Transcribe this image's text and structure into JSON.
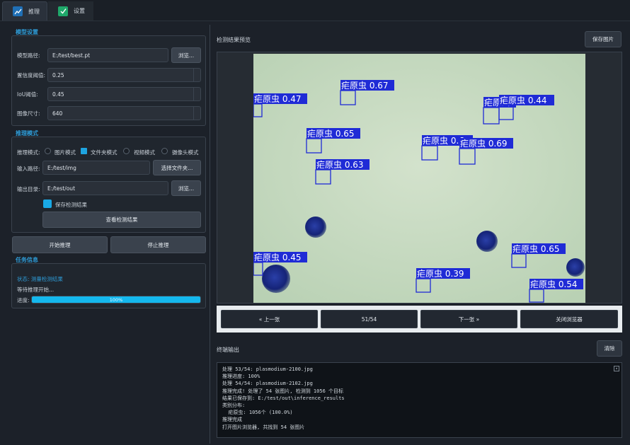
{
  "tabs": [
    {
      "label": "推理",
      "icon": "chart-line-icon",
      "active": true
    },
    {
      "label": "设置",
      "icon": "check-square-icon",
      "active": false
    }
  ],
  "model_settings": {
    "title": "模型设置",
    "model_path_label": "模型路径:",
    "model_path_value": "E:/test/best.pt",
    "browse_label": "浏览...",
    "confidence_label": "置信度阈值:",
    "confidence_value": "0.25",
    "iou_label": "IoU阈值:",
    "iou_value": "0.45",
    "image_size_label": "图像尺寸:",
    "image_size_value": "640"
  },
  "inference_mode": {
    "title": "推理模式",
    "mode_label": "推理模式:",
    "options": [
      "图片模式",
      "文件夹模式",
      "视频模式",
      "摄像头模式"
    ],
    "selected": "文件夹模式",
    "input_label": "输入路径:",
    "input_value": "E:/test/img",
    "choose_folder_label": "选择文件夹...",
    "output_label": "输出目录:",
    "output_value": "E:/test/out",
    "browse_label": "浏览...",
    "save_results_label": "保存检测结果",
    "view_results_label": "查看检测结果"
  },
  "actions": {
    "start_label": "开始推理",
    "stop_label": "停止推理"
  },
  "task_info": {
    "title": "任务信息",
    "status_text": "状态: 测量检测结果",
    "waiting_text": "等待推理开始...",
    "progress_label": "进度:",
    "progress_text": "100%",
    "progress_value": 100
  },
  "preview": {
    "title": "检测结果预览",
    "save_image_label": "保存图片",
    "detections": [
      {
        "label": "疟原虫 0.47"
      },
      {
        "label": "疟原虫 0.67"
      },
      {
        "label": "疟原虫"
      },
      {
        "label": "疟原虫 0.44"
      },
      {
        "label": "疟原虫 0.65"
      },
      {
        "label": "疟原虫 0.6"
      },
      {
        "label": "疟原虫 0.69"
      },
      {
        "label": "疟原虫 0.63"
      },
      {
        "label": "疟原虫 0.45"
      },
      {
        "label": "疟原虫 0.39"
      },
      {
        "label": "疟原虫 0.65"
      },
      {
        "label": "疟原虫 0.54"
      }
    ],
    "colors": {
      "box": "#1f2bd6",
      "background": "#c8dcc2"
    }
  },
  "navigation": {
    "prev_label": "« 上一张",
    "counter": "51/54",
    "next_label": "下一张 »",
    "close_label": "关闭浏览器"
  },
  "terminal": {
    "title": "终端输出",
    "clear_label": "清除",
    "lines": [
      "处理 53/54: plasmodium-2100.jpg",
      "推理进度: 100%",
      "处理 54/54: plasmodium-2102.jpg",
      "推理完成! 处理了 54 张图片, 检测到 1056 个目标",
      "结果已保存到: E:/test/out\\inference_results",
      "类别分布:",
      "  疟原虫: 1056个 (100.0%)",
      "推理完成",
      "打开图片浏览器, 共找到 54 张图片"
    ]
  }
}
